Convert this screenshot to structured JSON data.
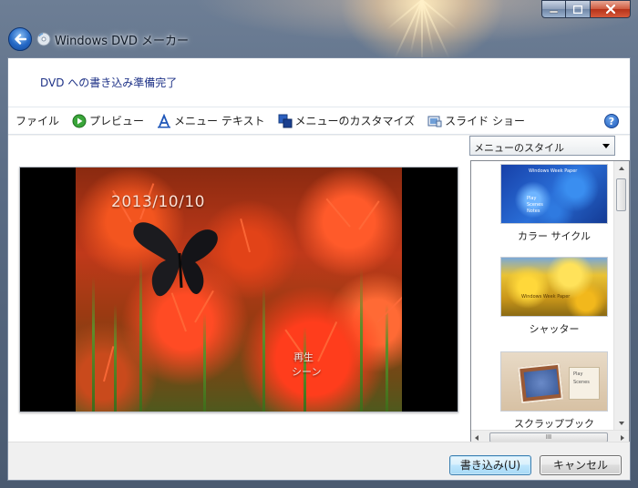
{
  "window": {
    "title": "Windows DVD メーカー",
    "controls": {
      "minimize": "minimize-icon",
      "maximize": "maximize-icon",
      "close": "close-icon"
    }
  },
  "banner": {
    "text": "DVD への書き込み準備完了"
  },
  "toolbar": {
    "items": [
      {
        "label": "ファイル",
        "icon": ""
      },
      {
        "label": "プレビュー",
        "icon": "play-icon"
      },
      {
        "label": "メニュー テキスト",
        "icon": "text-icon"
      },
      {
        "label": "メニューのカスタマイズ",
        "icon": "customize-icon"
      },
      {
        "label": "スライド ショー",
        "icon": "slideshow-icon"
      }
    ],
    "help_icon": "?"
  },
  "preview": {
    "date_text": "2013/10/10",
    "menu_play": "再生",
    "menu_scenes": "シーン"
  },
  "style_panel": {
    "selected": "メニューのスタイル",
    "styles": [
      {
        "label": "カラー サイクル",
        "thumb_title": "Windows Week Paper",
        "thumb_lines": [
          "Play",
          "Scenes",
          "Notes"
        ]
      },
      {
        "label": "シャッター",
        "thumb_title": "Windows Week Paper"
      },
      {
        "label": "スクラップブック",
        "thumb_lines": [
          "Play",
          "Scenes"
        ]
      }
    ],
    "hscroll_grip": "III"
  },
  "footer": {
    "burn_label": "書き込み(U)",
    "cancel_label": "キャンセル"
  },
  "colors": {
    "banner_text": "#1e3287",
    "primary_button_border": "#3c7fb1",
    "close_button": "#c8432a"
  }
}
